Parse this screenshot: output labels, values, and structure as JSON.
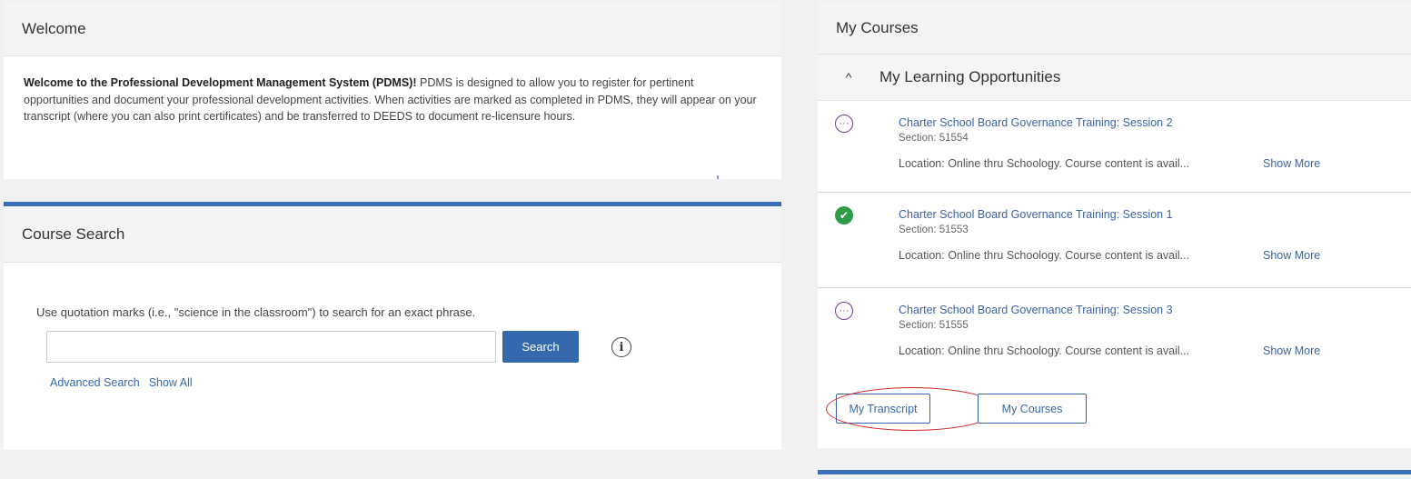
{
  "welcome": {
    "title": "Welcome",
    "intro_bold": "Welcome to the Professional Development Management System (PDMS)!",
    "intro_text": " PDMS is designed to allow you to register for pertinent opportunities and document your professional development activities. When activities are marked as completed in PDMS, they will appear on your transcript (where you can also print certificates) and be transferred to DEEDS to document re-licensure hours."
  },
  "course_search": {
    "title": "Course Search",
    "hint": "Use quotation marks (i.e., \"science in the classroom\") to search for an exact phrase.",
    "input_value": "",
    "search_label": "Search",
    "info_glyph": "i",
    "advanced_search": "Advanced Search",
    "show_all": "Show All"
  },
  "my_courses": {
    "title": "My Courses",
    "section_title": "My Learning Opportunities",
    "chevron_glyph": "^",
    "items": [
      {
        "status": "pending",
        "status_glyph": "···",
        "title": "Charter School Board Governance Training: Session 2",
        "section": "Section: 51554",
        "location": "Location: Online thru Schoology. Course content is avail...",
        "show_more": "Show More"
      },
      {
        "status": "completed",
        "status_glyph": "✔",
        "title": "Charter School Board Governance Training: Session 1",
        "section": "Section: 51553",
        "location": "Location: Online thru Schoology. Course content is avail...",
        "show_more": "Show More"
      },
      {
        "status": "pending",
        "status_glyph": "···",
        "title": "Charter School Board Governance Training: Session 3",
        "section": "Section: 51555",
        "location": "Location: Online thru Schoology. Course content is avail...",
        "show_more": "Show More"
      }
    ],
    "transcript_button": "My Transcript",
    "courses_button": "My Courses"
  },
  "colors": {
    "accent_blue": "#3569ae",
    "pending_purple": "#7a3d8f",
    "completed_green": "#2e9b47",
    "annotation_red": "#d42020"
  }
}
